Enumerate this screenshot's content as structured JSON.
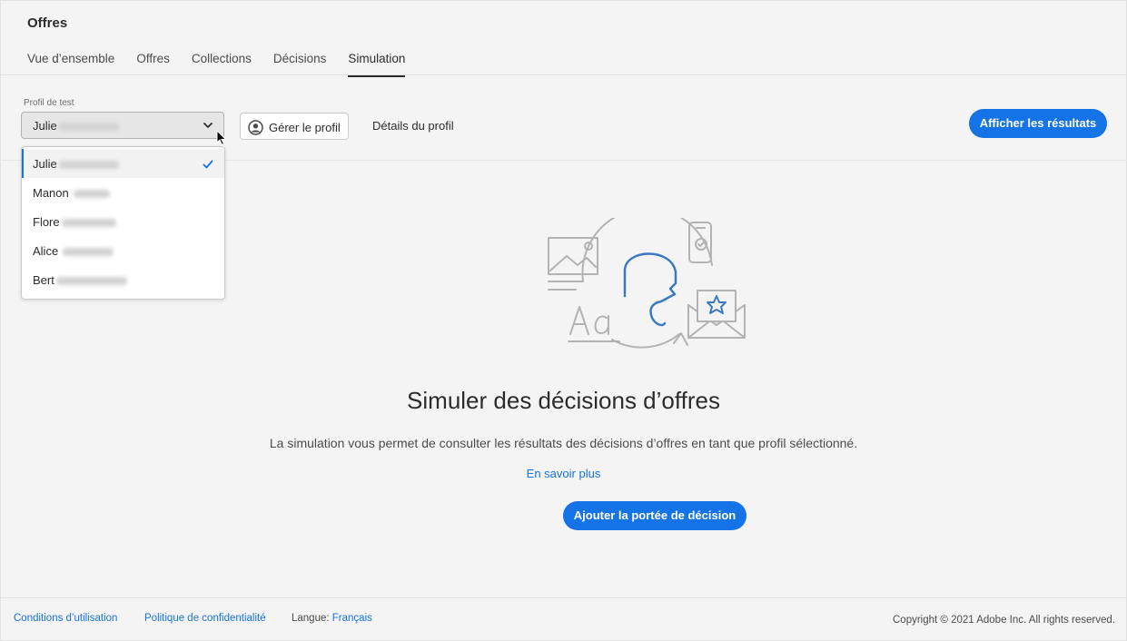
{
  "header": {
    "title": "Offres"
  },
  "tabs": [
    {
      "label": "Vue d’ensemble",
      "active": false
    },
    {
      "label": "Offres",
      "active": false
    },
    {
      "label": "Collections",
      "active": false
    },
    {
      "label": "Décisions",
      "active": false
    },
    {
      "label": "Simulation",
      "active": true
    }
  ],
  "toolbar": {
    "profile_label": "Profil de test",
    "profile_value": "Julie",
    "manage_profile": "Gérer le profil",
    "profile_details": "Détails du profil",
    "show_results": "Afficher les résultats"
  },
  "dropdown": {
    "options": [
      {
        "name": "Julie",
        "selected": true
      },
      {
        "name": "Manon",
        "selected": false
      },
      {
        "name": "Flore",
        "selected": false
      },
      {
        "name": "Alice",
        "selected": false
      },
      {
        "name": "Bert",
        "selected": false
      }
    ]
  },
  "empty_state": {
    "title": "Simuler des décisions d’offres",
    "description": "La simulation vous permet de consulter les résultats des décisions d’offres en tant que profil sélectionné.",
    "learn_more": "En savoir plus",
    "add_scope": "Ajouter la portée de décision"
  },
  "footer": {
    "terms": "Conditions d’utilisation",
    "privacy": "Politique de confidentialité",
    "language_label": "Langue:",
    "language_value": "Français",
    "copyright": "Copyright © 2021 Adobe Inc. All rights reserved."
  },
  "colors": {
    "accent": "#1473e6",
    "background": "#f4f4f4"
  },
  "icons": [
    "chevron-down-icon",
    "user-circle-icon",
    "checkmark-icon",
    "cursor-icon"
  ]
}
